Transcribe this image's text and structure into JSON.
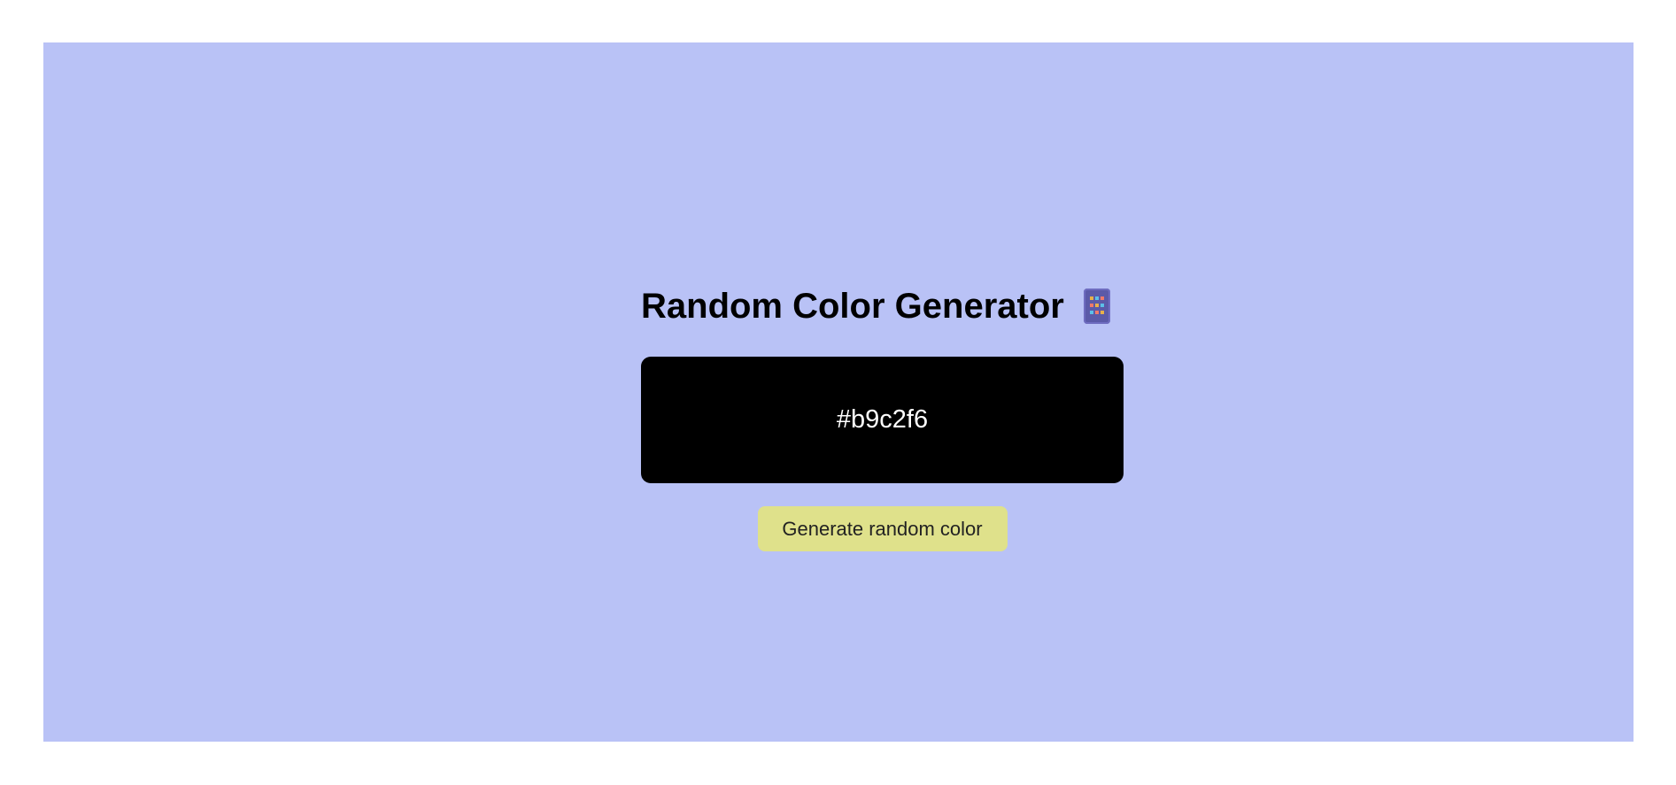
{
  "page": {
    "background_color": "#b9c2f6"
  },
  "header": {
    "title": "Random Color Generator",
    "icon": "palette-icon"
  },
  "display": {
    "color_code": "#b9c2f6",
    "box_color": "#000000",
    "text_color": "#ffffff"
  },
  "actions": {
    "generate_label": "Generate random color",
    "button_color": "#dfe18b"
  }
}
